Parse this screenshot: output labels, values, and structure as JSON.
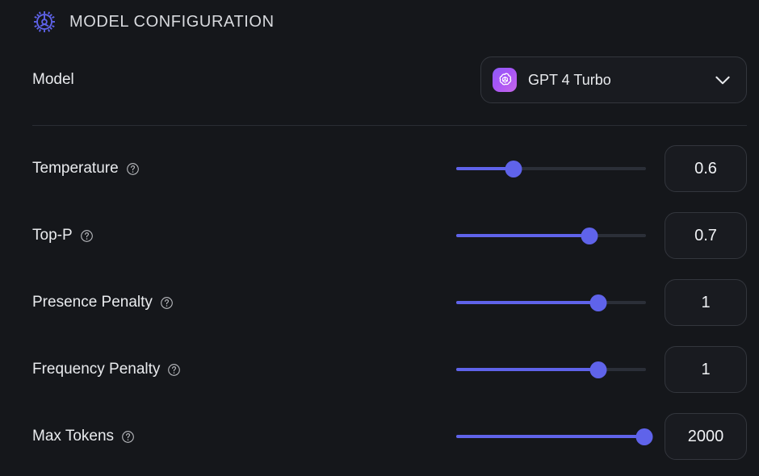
{
  "header": {
    "title": "MODEL CONFIGURATION",
    "icon": "gear-icon"
  },
  "model": {
    "label": "Model",
    "selected": "GPT 4 Turbo",
    "provider_icon": "openai-logo-icon",
    "chevron_icon": "chevron-down-icon"
  },
  "colors": {
    "background": "#15171b",
    "accent": "#5f63ea",
    "track": "#2b2f38",
    "border": "#33363d",
    "text": "#e9ebee",
    "badge_gradient_start": "#8b5cf6",
    "badge_gradient_end": "#c667e8"
  },
  "parameters": [
    {
      "name": "temperature",
      "label": "Temperature",
      "help_icon": "help-circle-icon",
      "value": "0.6",
      "percent": 30
    },
    {
      "name": "top-p",
      "label": "Top-P",
      "help_icon": "help-circle-icon",
      "value": "0.7",
      "percent": 70
    },
    {
      "name": "presence-penalty",
      "label": "Presence Penalty",
      "help_icon": "help-circle-icon",
      "value": "1",
      "percent": 75
    },
    {
      "name": "frequency-penalty",
      "label": "Frequency Penalty",
      "help_icon": "help-circle-icon",
      "value": "1",
      "percent": 75
    },
    {
      "name": "max-tokens",
      "label": "Max Tokens",
      "help_icon": "help-circle-icon",
      "value": "2000",
      "percent": 99
    }
  ]
}
